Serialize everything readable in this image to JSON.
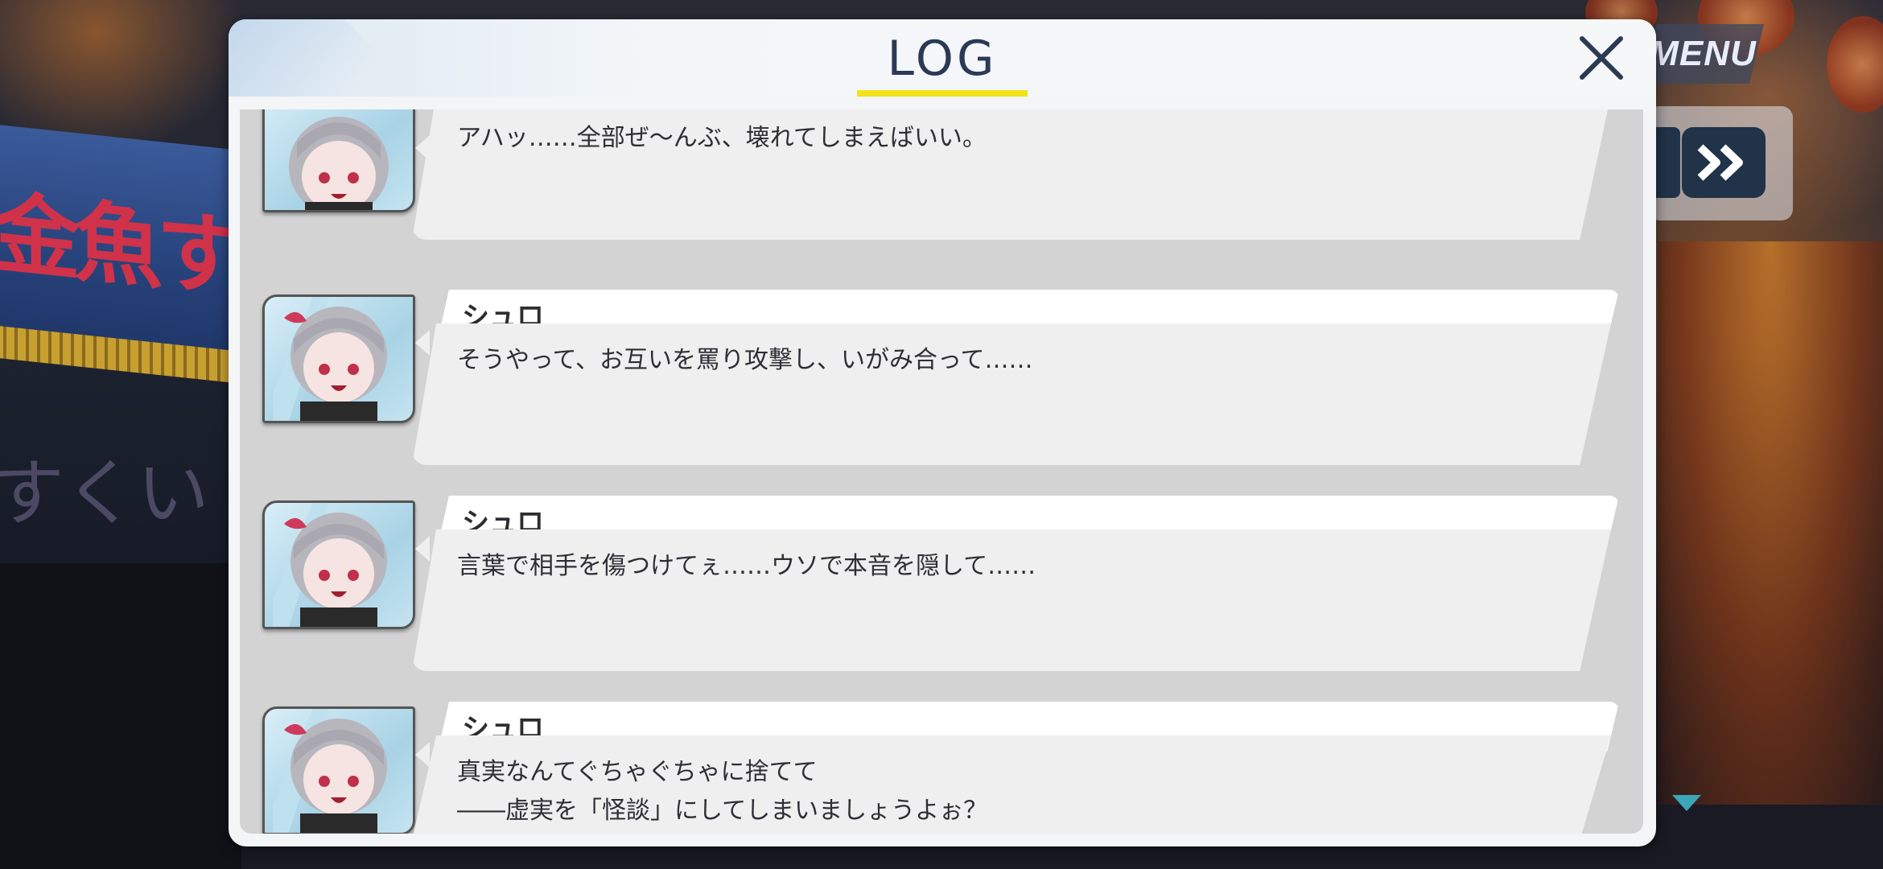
{
  "hud": {
    "menu_label": "MENU",
    "fast_forward_icon": "double-chevron-right-icon"
  },
  "log": {
    "title": "LOG",
    "close_icon": "close-icon",
    "accent_color": "#f2e21c",
    "entries": [
      {
        "speaker": "",
        "text": "アハッ……全部ぜ〜んぶ、壊れてしまえばいい。"
      },
      {
        "speaker": "シュロ",
        "text": "そうやって、お互いを罵り攻撃し、いがみ合って……"
      },
      {
        "speaker": "シュロ",
        "text": "言葉で相手を傷つけてぇ……ウソで本音を隠して……"
      },
      {
        "speaker": "シュロ",
        "text": "真実なんてぐちゃぐちゃに捨てて\n――虚実を「怪談」にしてしまいましょうよぉ？"
      }
    ]
  }
}
